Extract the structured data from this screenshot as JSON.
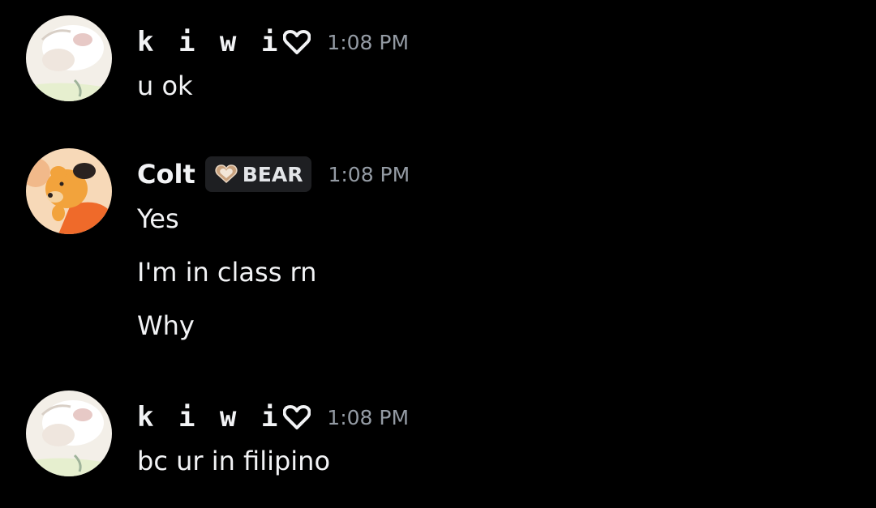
{
  "messages": [
    {
      "author": "k i w i",
      "author_icon": "heart-outline-icon",
      "timestamp": "1:08 PM",
      "lines": [
        "u ok"
      ]
    },
    {
      "author": "Colt",
      "role_tag": {
        "icon": "heart-badge-icon",
        "label": "BEAR"
      },
      "timestamp": "1:08 PM",
      "lines": [
        "Yes",
        "I'm in class rn",
        "Why"
      ]
    },
    {
      "author": "k i w i",
      "author_icon": "heart-outline-icon",
      "timestamp": "1:08 PM",
      "lines": [
        "bc ur in filipino"
      ]
    }
  ],
  "colors": {
    "background": "#000000",
    "text": "#f2f3f5",
    "timestamp": "#949ba4",
    "role_tag_bg": "#1e1f22",
    "role_icon": "#c9a27e"
  }
}
